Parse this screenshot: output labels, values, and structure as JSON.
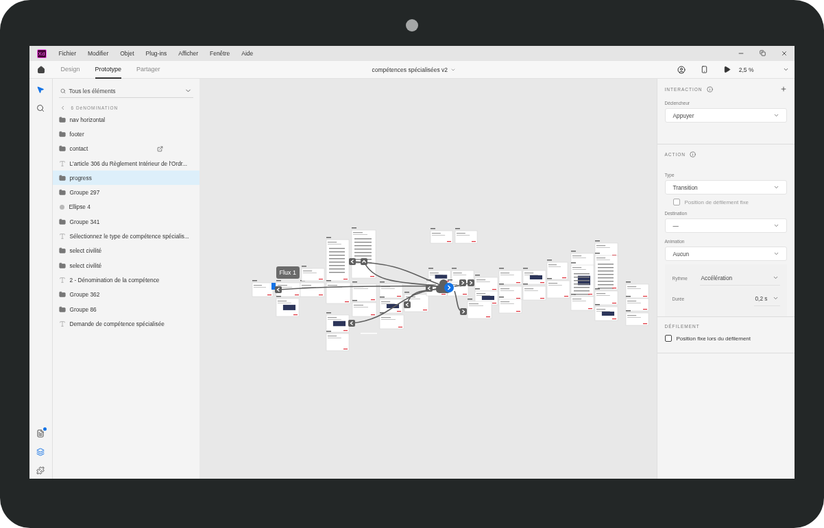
{
  "title_bar": {
    "app_logo": "Xd",
    "menu": [
      "Fichier",
      "Modifier",
      "Objet",
      "Plug-ins",
      "Afficher",
      "Fenêtre",
      "Aide"
    ]
  },
  "toolbar": {
    "tabs": [
      {
        "label": "Design",
        "selected": false
      },
      {
        "label": "Prototype",
        "selected": true
      },
      {
        "label": "Partager",
        "selected": false
      }
    ],
    "document_title": "compétences spécialisées v2",
    "zoom": "2,5 %"
  },
  "tool_rail": {
    "top": [
      {
        "selected": true
      },
      {
        "selected": false
      }
    ],
    "bottom": [
      {
        "selected": false,
        "badge": true
      },
      {
        "selected": true,
        "badge": false
      },
      {
        "selected": false,
        "badge": false
      }
    ]
  },
  "layers": {
    "search": {
      "placeholder": "Tous les éléments"
    },
    "breadcrumb": "6 DéNOMINATION",
    "items": [
      {
        "kind": "folder",
        "name": "nav horizontal",
        "selected": false,
        "linked": false
      },
      {
        "kind": "folder",
        "name": "footer",
        "selected": false,
        "linked": false
      },
      {
        "kind": "folder",
        "name": "contact",
        "selected": false,
        "linked": true
      },
      {
        "kind": "text",
        "name": "L'article 306 du Règlement Intérieur de l'Ordr...",
        "selected": false,
        "linked": false
      },
      {
        "kind": "folder",
        "name": "progress",
        "selected": true,
        "linked": false
      },
      {
        "kind": "folder",
        "name": "Groupe 297",
        "selected": false,
        "linked": false
      },
      {
        "kind": "ellipse",
        "name": "Ellipse 4",
        "selected": false,
        "linked": false
      },
      {
        "kind": "folder",
        "name": "Groupe 341",
        "selected": false,
        "linked": false
      },
      {
        "kind": "text",
        "name": "Sélectionnez le type de compétence spécialis...",
        "selected": false,
        "linked": false
      },
      {
        "kind": "folder",
        "name": "select civilité",
        "selected": false,
        "linked": false
      },
      {
        "kind": "folder",
        "name": "select civilité",
        "selected": false,
        "linked": false
      },
      {
        "kind": "text",
        "name": "2 - Dénomination de la compétence",
        "selected": false,
        "linked": false
      },
      {
        "kind": "folder",
        "name": "Groupe 362",
        "selected": false,
        "linked": false
      },
      {
        "kind": "folder",
        "name": "Groupe 86",
        "selected": false,
        "linked": false
      },
      {
        "kind": "text",
        "name": "Demande de compétence spécialisée",
        "selected": false,
        "linked": false
      }
    ]
  },
  "canvas": {
    "flow_label": "Flux 1"
  },
  "properties": {
    "interaction": {
      "title": "INTERACTION",
      "trigger_label": "Déclencheur",
      "trigger": "Appuyer"
    },
    "action": {
      "title": "ACTION",
      "type_label": "Type",
      "type": "Transition",
      "fixed_scroll": {
        "label": "Position de défilement fixe",
        "checked": false,
        "disabled": true
      },
      "destination_label": "Destination",
      "destination": "—",
      "animation_label": "Animation",
      "animation": "Aucun",
      "easing_label": "Rythme",
      "easing": "Accélération",
      "duration_label": "Durée",
      "duration": "0,2 s"
    },
    "scrolling": {
      "title": "DÉFILEMENT",
      "fixed_position": {
        "label": "Position fixe lors du défilement",
        "checked": false,
        "disabled": false
      }
    }
  }
}
